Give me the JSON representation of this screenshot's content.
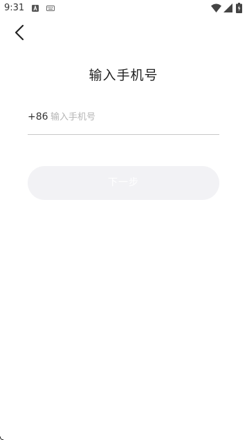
{
  "status_bar": {
    "time": "9:31",
    "icons": [
      "a-icon",
      "keyboard-icon",
      "wifi-icon",
      "signal-icon",
      "battery-icon"
    ]
  },
  "header": {
    "back_icon": "chevron-left-icon"
  },
  "main": {
    "title": "输入手机号",
    "country_code": "+86",
    "phone_placeholder": "输入手机号",
    "phone_value": "",
    "next_label": "下一步"
  },
  "colors": {
    "background": "#ffffff",
    "text": "#222222",
    "placeholder": "#b5b5b5",
    "divider": "#c8c8c8",
    "next_button_disabled_bg": "#f2f2f5",
    "next_button_text": "#ffffff"
  }
}
